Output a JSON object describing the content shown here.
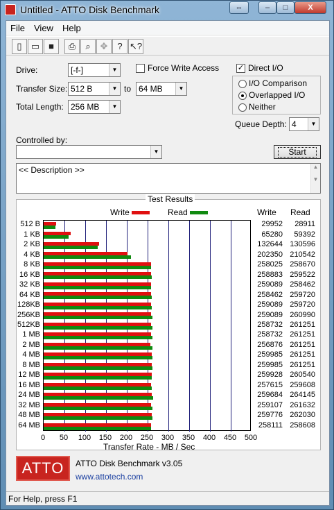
{
  "window": {
    "title": "Untitled - ATTO Disk Benchmark"
  },
  "titlebar_buttons": {
    "swap": "⇔",
    "minimize": "–",
    "maximize": "□",
    "close": "X"
  },
  "menu": [
    "File",
    "View",
    "Help"
  ],
  "toolbar": {
    "icons": [
      "new-icon",
      "open-icon",
      "save-icon",
      "print-icon",
      "print-preview-icon",
      "move-icon",
      "help-icon",
      "context-help-icon"
    ]
  },
  "form": {
    "drive_label": "Drive:",
    "drive_value": "[-f-]",
    "force_write_label": "Force Write Access",
    "force_write_checked": false,
    "direct_io_label": "Direct I/O",
    "direct_io_checked": true,
    "transfer_size_label": "Transfer Size:",
    "transfer_from": "512 B",
    "to_label": "to",
    "transfer_to": "64 MB",
    "total_length_label": "Total Length:",
    "total_length": "256 MB",
    "io_comparison_label": "I/O Comparison",
    "overlapped_io_label": "Overlapped I/O",
    "neither_label": "Neither",
    "selected_mode": "Overlapped I/O",
    "queue_depth_label": "Queue Depth:",
    "queue_depth": "4",
    "controlled_by_label": "Controlled by:",
    "controlled_by_value": "",
    "start_button": "Start",
    "description": "<< Description >>"
  },
  "results": {
    "title": "Test Results",
    "write_legend": "Write",
    "read_legend": "Read",
    "write_header": "Write",
    "read_header": "Read",
    "xlabel": "Transfer Rate - MB / Sec"
  },
  "colors": {
    "write": "#e01010",
    "read": "#108a10",
    "grid": "#1f1f7a"
  },
  "chart_data": {
    "type": "bar",
    "orientation": "horizontal",
    "xlabel": "Transfer Rate - MB / Sec",
    "xlim": [
      0,
      500
    ],
    "xticks": [
      "0",
      "50",
      "100",
      "150",
      "200",
      "250",
      "300",
      "350",
      "400",
      "450",
      "500"
    ],
    "categories": [
      "512 B",
      "1 KB",
      "2 KB",
      "4 KB",
      "8 KB",
      "16 KB",
      "32 KB",
      "64 KB",
      "128KB",
      "256KB",
      "512KB",
      "1 MB",
      "2 MB",
      "4 MB",
      "8 MB",
      "12 MB",
      "16 MB",
      "24 MB",
      "32 MB",
      "48 MB",
      "64 MB"
    ],
    "series": [
      {
        "name": "Write",
        "values": [
          29.9,
          65.3,
          132.6,
          202.4,
          258.0,
          258.9,
          259.1,
          258.5,
          259.1,
          259.1,
          258.7,
          258.7,
          256.9,
          260.0,
          260.0,
          259.9,
          257.6,
          259.7,
          259.1,
          259.8,
          258.1
        ]
      },
      {
        "name": "Read",
        "values": [
          28.9,
          59.4,
          130.6,
          210.5,
          258.7,
          259.5,
          258.5,
          259.7,
          259.7,
          261.0,
          261.3,
          261.3,
          261.3,
          261.3,
          261.3,
          260.5,
          259.6,
          264.1,
          261.6,
          262.0,
          258.6
        ]
      }
    ],
    "write_kbs": [
      "29952",
      "65280",
      "132644",
      "202350",
      "258025",
      "258883",
      "259089",
      "258462",
      "259089",
      "259089",
      "258732",
      "258732",
      "256876",
      "259985",
      "259985",
      "259928",
      "257615",
      "259684",
      "259107",
      "259776",
      "258111"
    ],
    "read_kbs": [
      "28911",
      "59392",
      "130596",
      "210542",
      "258670",
      "259522",
      "258462",
      "259720",
      "259720",
      "260990",
      "261251",
      "261251",
      "261251",
      "261251",
      "261251",
      "260540",
      "259608",
      "264145",
      "261632",
      "262030",
      "258608"
    ],
    "grid": true,
    "legend": "top-center"
  },
  "footer": {
    "logo_text": "ATTO",
    "app_name": "ATTO Disk Benchmark v3.05",
    "url": "www.attotech.com"
  },
  "status": {
    "text": "For Help, press F1"
  }
}
